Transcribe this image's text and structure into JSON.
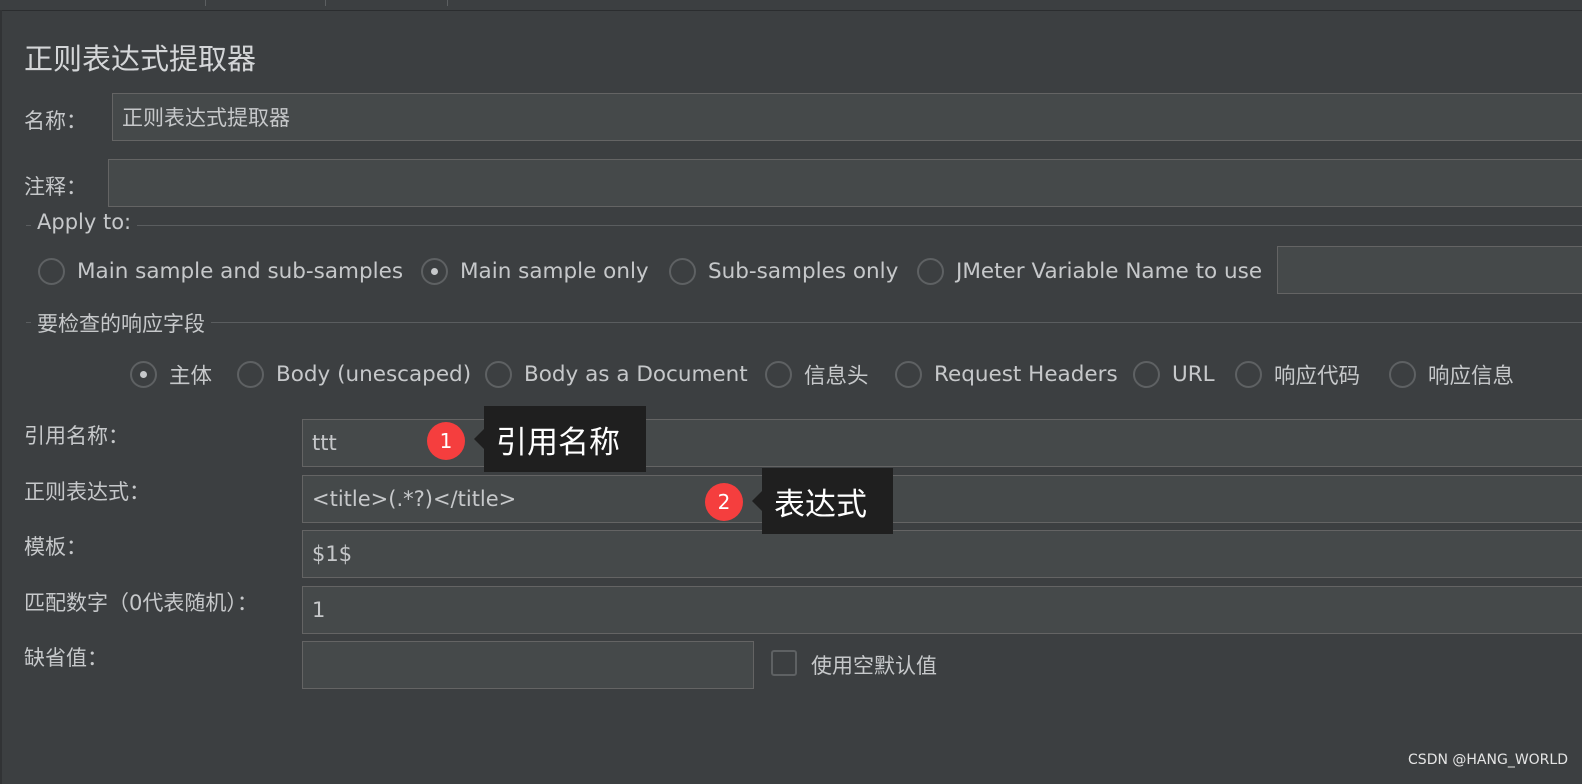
{
  "panel": {
    "title": "正则表达式提取器"
  },
  "name_field": {
    "label": "名称：",
    "value": "正则表达式提取器"
  },
  "comment_field": {
    "label": "注释：",
    "value": ""
  },
  "apply_to": {
    "title": "Apply to:",
    "options": [
      {
        "label": "Main sample and sub-samples",
        "checked": false
      },
      {
        "label": "Main sample only",
        "checked": true
      },
      {
        "label": "Sub-samples only",
        "checked": false
      },
      {
        "label": "JMeter Variable Name to use",
        "checked": false
      }
    ],
    "variable_value": ""
  },
  "response_field": {
    "title": "要检查的响应字段",
    "options": [
      {
        "label": "主体",
        "checked": true
      },
      {
        "label": "Body (unescaped)",
        "checked": false
      },
      {
        "label": "Body as a Document",
        "checked": false
      },
      {
        "label": "信息头",
        "checked": false
      },
      {
        "label": "Request Headers",
        "checked": false
      },
      {
        "label": "URL",
        "checked": false
      },
      {
        "label": "响应代码",
        "checked": false
      },
      {
        "label": "响应信息",
        "checked": false
      }
    ]
  },
  "form": {
    "ref_name": {
      "label": "引用名称：",
      "value": "ttt"
    },
    "regex": {
      "label": "正则表达式：",
      "value": "<title>(.*?)</title>"
    },
    "template": {
      "label": "模板：",
      "value": "$1$"
    },
    "match_no": {
      "label": "匹配数字（0代表随机）：",
      "value": "1"
    },
    "default_value": {
      "label": "缺省值：",
      "value": ""
    },
    "use_empty_default": {
      "label": "使用空默认值",
      "checked": false
    }
  },
  "annotations": [
    {
      "number": "1",
      "text": "引用名称"
    },
    {
      "number": "2",
      "text": "表达式"
    }
  ],
  "watermark": "CSDN @HANG_WORLD",
  "colors": {
    "background": "#3c3f41",
    "field": "#45494a",
    "badge": "#f53e3e",
    "callout": "#1f1f1f"
  }
}
